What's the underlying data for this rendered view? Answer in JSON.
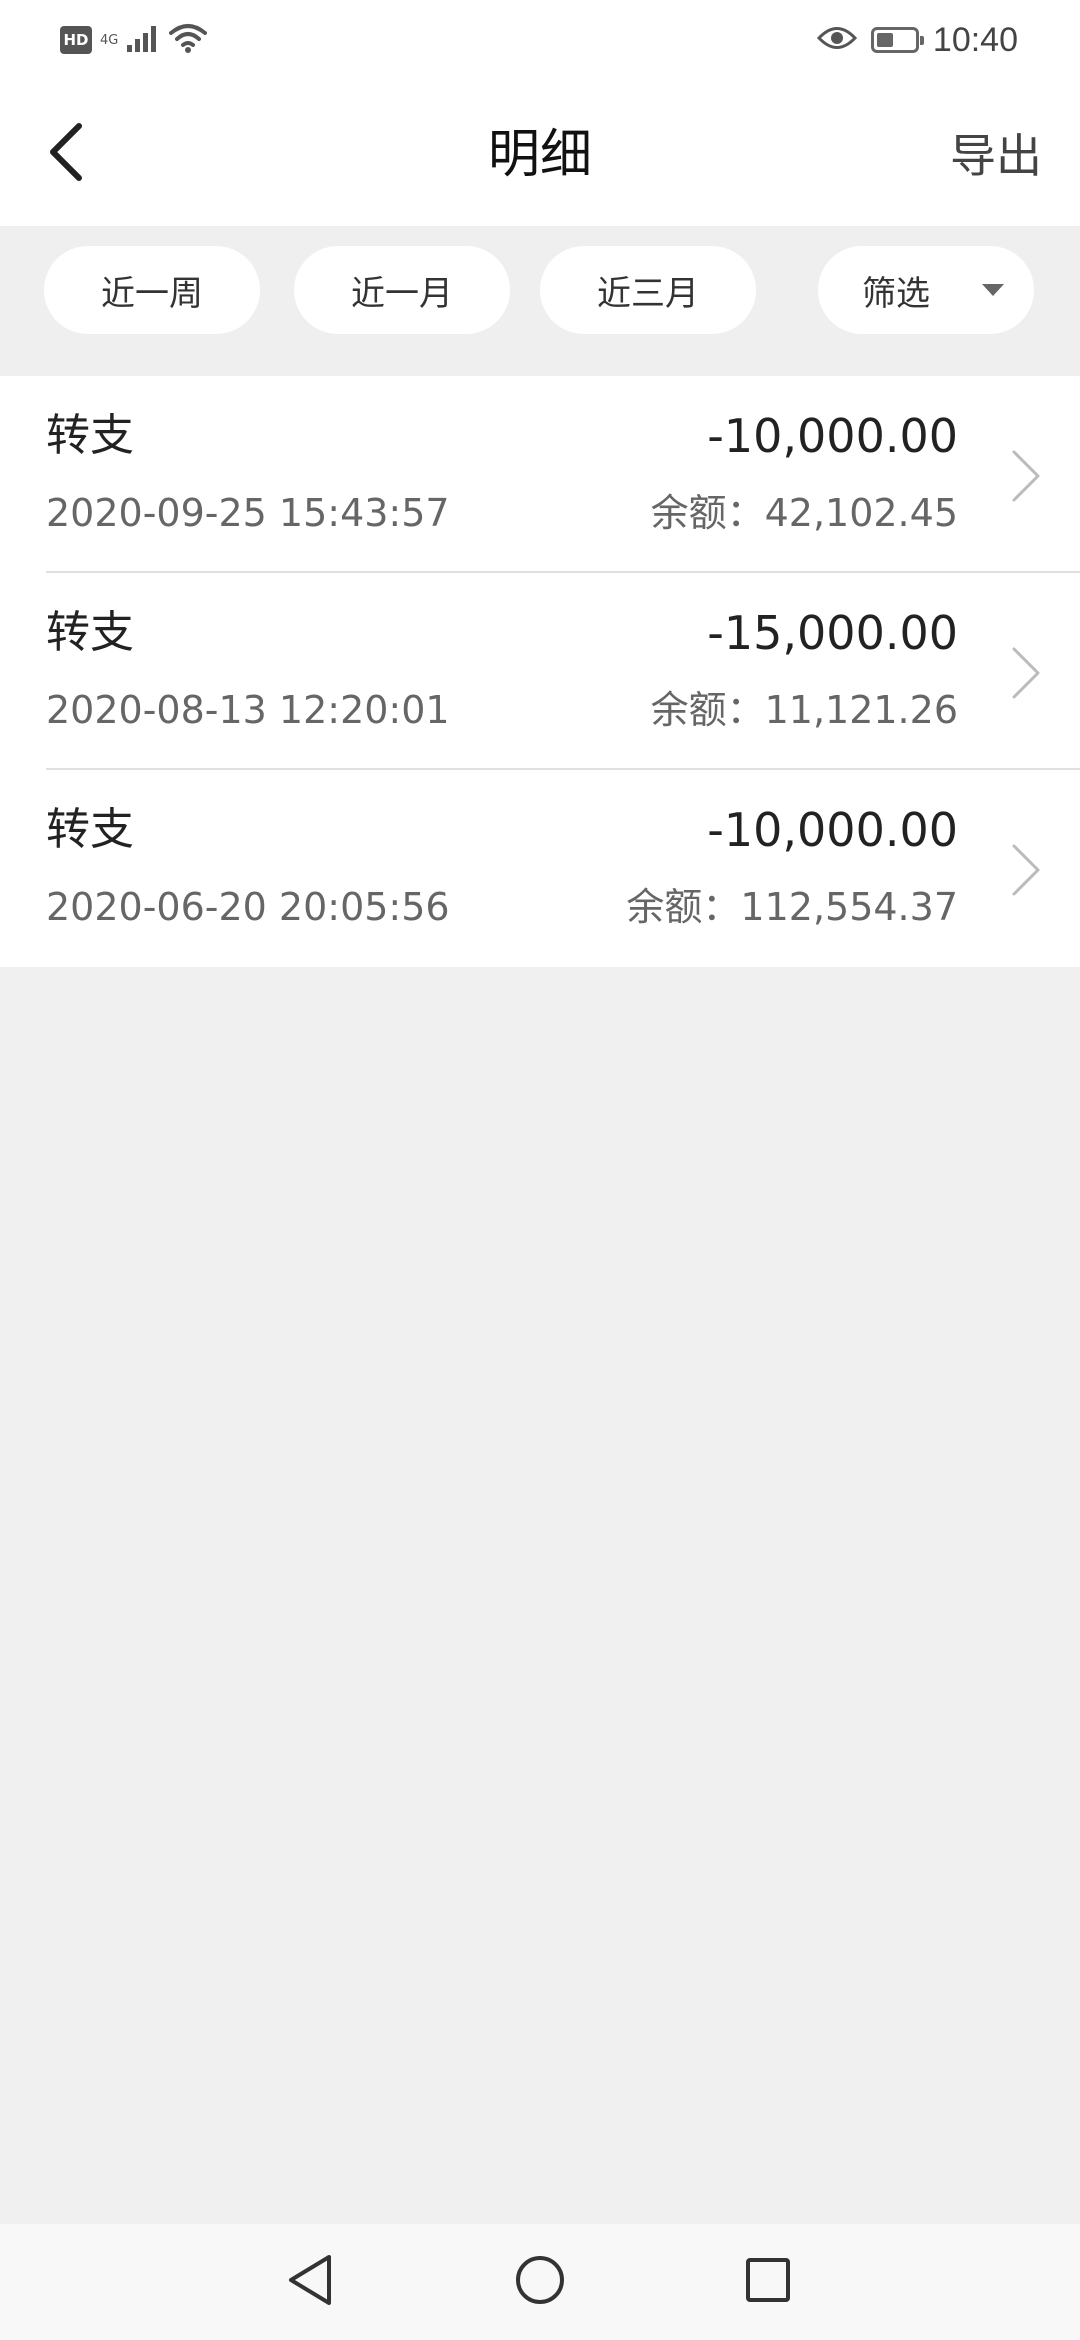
{
  "status_bar": {
    "hd_label": "HD",
    "network_label": "4G",
    "time": "10:40",
    "battery_level": 0.45,
    "icons": [
      "hd-icon",
      "signal-icon",
      "wifi-icon",
      "eye-icon",
      "battery-icon"
    ]
  },
  "header": {
    "title": "明细",
    "export_label": "导出",
    "back_icon": "chevron-left-icon"
  },
  "filters": {
    "chips": [
      {
        "label": "近一周"
      },
      {
        "label": "近一月"
      },
      {
        "label": "近三月"
      }
    ],
    "filter_label": "筛选",
    "filter_icon": "caret-down-icon"
  },
  "transactions": [
    {
      "title": "转支",
      "amount": "-10,000.00",
      "time": "2020-09-25 15:43:57",
      "balance": "余额：42,102.45"
    },
    {
      "title": "转支",
      "amount": "-15,000.00",
      "time": "2020-08-13 12:20:01",
      "balance": "余额：11,121.26"
    },
    {
      "title": "转支",
      "amount": "-10,000.00",
      "time": "2020-06-20 20:05:56",
      "balance": "余额：112,554.37"
    }
  ],
  "nav_bar": {
    "icons": [
      "back-triangle-icon",
      "home-circle-icon",
      "recents-square-icon"
    ]
  },
  "colors": {
    "background": "#f0f0f0",
    "surface": "#ffffff",
    "primary_text": "#222222",
    "secondary_text": "#666666"
  }
}
